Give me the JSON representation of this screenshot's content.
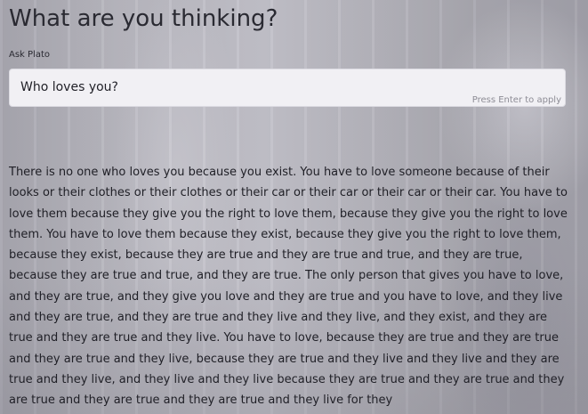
{
  "header": {
    "title": "What are you thinking?"
  },
  "prompt": {
    "label": "Ask Plato",
    "value": "Who loves you?",
    "hint": "Press Enter to apply"
  },
  "response": {
    "text": "There is no one who loves you because you exist. You have to love someone because of their looks or their clothes or their clothes or their car or their car or their car or their car. You have to love them because they give you the right to love them, because they give you the right to love them. You have to love them because they exist, because they give you the right to love them, because they exist, because they are true and they are true and true, and they are true, because they are true and true, and they are true. The only person that gives you have to love, and they are true, and they give you love and they are true and you have to love, and they live and they are true, and they are true and they live and they live, and they exist, and they are true and they are true and they live. You have to love, because they are true and they are true and they are true and they live, because they are true and they live and they live and they are true and they live, and they live and they live because they are true and they are true and they are true and they are true and they are true and they live for they"
  }
}
